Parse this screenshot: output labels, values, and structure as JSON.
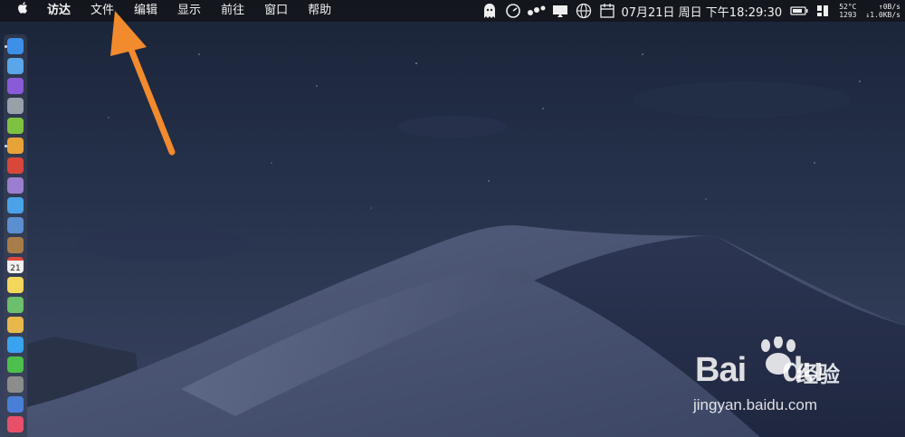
{
  "menubar": {
    "apple_icon": "apple-icon",
    "items": [
      "访达",
      "文件",
      "编辑",
      "显示",
      "前往",
      "窗口",
      "帮助"
    ]
  },
  "status": {
    "icons": [
      "ghost-icon",
      "speedometer-icon",
      "dots-icon",
      "display-icon",
      "globe-icon",
      "calendar-icon"
    ],
    "clock": "07月21日 周日 下午18:29:30",
    "temp": "52°C",
    "fan": "1293",
    "net_up": "↑0B/s",
    "net_down": "↓1.0KB/s"
  },
  "dock": {
    "icons": [
      {
        "name": "finder-icon",
        "color": "#3d8fe8"
      },
      {
        "name": "appstore-icon",
        "color": "#5aa6e8"
      },
      {
        "name": "siri-icon",
        "color": "#8a5ad8"
      },
      {
        "name": "launchpad-icon",
        "color": "#9aa0aa"
      },
      {
        "name": "android-icon",
        "color": "#7ec242"
      },
      {
        "name": "chrome-icon",
        "color": "#e8a23a"
      },
      {
        "name": "app-red-icon",
        "color": "#d8473a"
      },
      {
        "name": "calculator-icon",
        "color": "#9b7ed0"
      },
      {
        "name": "safari-icon",
        "color": "#4aa3e8"
      },
      {
        "name": "preview-icon",
        "color": "#5c8fd0"
      },
      {
        "name": "notebook-icon",
        "color": "#a87d4a"
      },
      {
        "name": "calendar-icon",
        "color": "#f0f0f0"
      },
      {
        "name": "notes-icon",
        "color": "#f2d75c"
      },
      {
        "name": "maps-icon",
        "color": "#6cbf6c"
      },
      {
        "name": "photos-icon",
        "color": "#e8b84a"
      },
      {
        "name": "messages-icon",
        "color": "#3aa3f0"
      },
      {
        "name": "wechat-icon",
        "color": "#4cbf4c"
      },
      {
        "name": "settings-icon",
        "color": "#8c8c8c"
      },
      {
        "name": "keynote-icon",
        "color": "#4a7fd8"
      },
      {
        "name": "music-icon",
        "color": "#e8506a"
      }
    ],
    "calendar_day": "21"
  },
  "watermark": {
    "logo": "Bai",
    "logo_suffix": "du",
    "brand": "经验",
    "url": "jingyan.baidu.com"
  },
  "colors": {
    "arrow": "#f28a2e",
    "menubar": "#14161c"
  }
}
